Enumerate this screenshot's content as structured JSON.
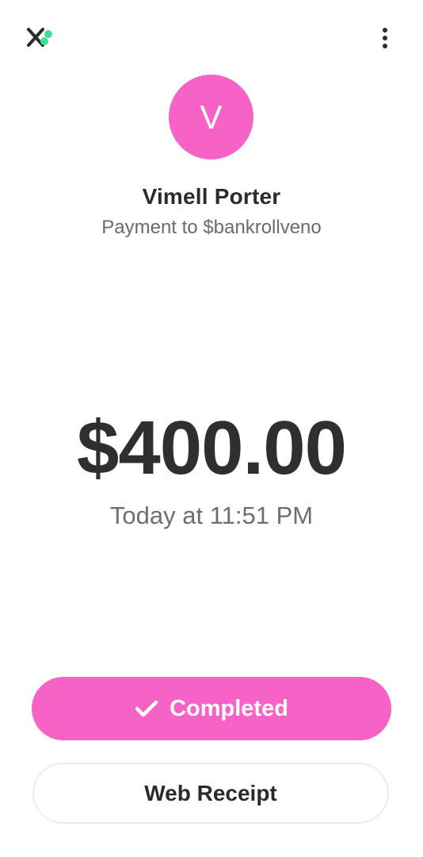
{
  "colors": {
    "accent": "#f762c6",
    "logo_green": "#3ee08f",
    "text_dark": "#2b2b2b",
    "text_muted": "#6b6b6b"
  },
  "top_bar": {
    "close_icon": "close-x-icon",
    "more_icon": "more-vertical-icon"
  },
  "recipient": {
    "avatar_initial": "V",
    "name": "Vimell Porter",
    "subtitle": "Payment to $bankrollveno"
  },
  "payment": {
    "amount": "$400.00",
    "timestamp": "Today at 11:51 PM"
  },
  "actions": {
    "status_label": "Completed",
    "status_icon": "checkmark-icon",
    "receipt_label": "Web Receipt"
  }
}
